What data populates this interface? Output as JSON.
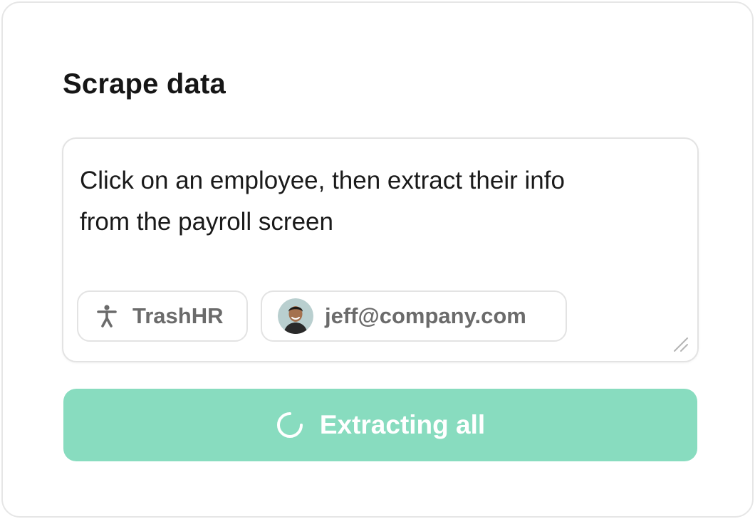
{
  "card": {
    "title": "Scrape data"
  },
  "prompt": {
    "value": "Click on an employee, then extract their info\nfrom the payroll screen"
  },
  "chips": {
    "app": {
      "label": "TrashHR",
      "icon": "accessibility-person-icon"
    },
    "user": {
      "label": "jeff@company.com",
      "icon": "avatar"
    }
  },
  "action": {
    "label": "Extracting all",
    "icon": "spinner-icon",
    "state": "loading"
  },
  "colors": {
    "button_bg": "#88dcbf",
    "chip_text": "#6b6b6b",
    "title_text": "#161616"
  }
}
